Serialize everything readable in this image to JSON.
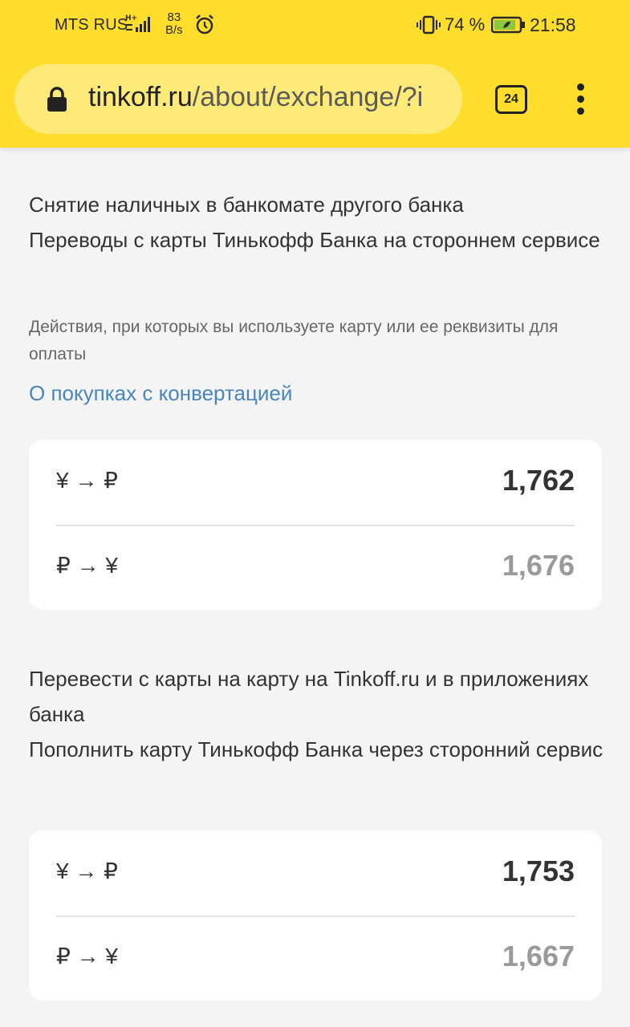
{
  "status_bar": {
    "carrier": "MTS RUS",
    "network_type": "H+",
    "speed_value": "83",
    "speed_unit": "B/s",
    "battery_percent": "74 %",
    "time": "21:58"
  },
  "browser": {
    "url_domain": "tinkoff.ru",
    "url_path": "/about/exchange/?i",
    "tab_count": "24"
  },
  "section1": {
    "lines": [
      "Снятие наличных в банкомате другого банка",
      "Переводы с карты Тинькофф Банка на стороннем сервисе"
    ],
    "subtitle": "Действия, при которых вы используете карту или ее реквизиты для оплаты",
    "link": "О покупках с конвертацией",
    "rates": [
      {
        "pair": "¥ → ₽",
        "value": "1,762"
      },
      {
        "pair": "₽ → ¥",
        "value": "1,676"
      }
    ]
  },
  "section2": {
    "lines": [
      "Перевести с карты на карту на Tinkoff.ru и в приложениях банка",
      "Пополнить карту Тинькофф Банка через сторонний сервис"
    ],
    "rates": [
      {
        "pair": "¥ → ₽",
        "value": "1,753"
      },
      {
        "pair": "₽ → ¥",
        "value": "1,667"
      }
    ]
  },
  "colors": {
    "brand_yellow": "#fedd2c",
    "url_pill": "#feea78",
    "link_blue": "#4a86bd",
    "page_bg": "#f4f4f4"
  }
}
